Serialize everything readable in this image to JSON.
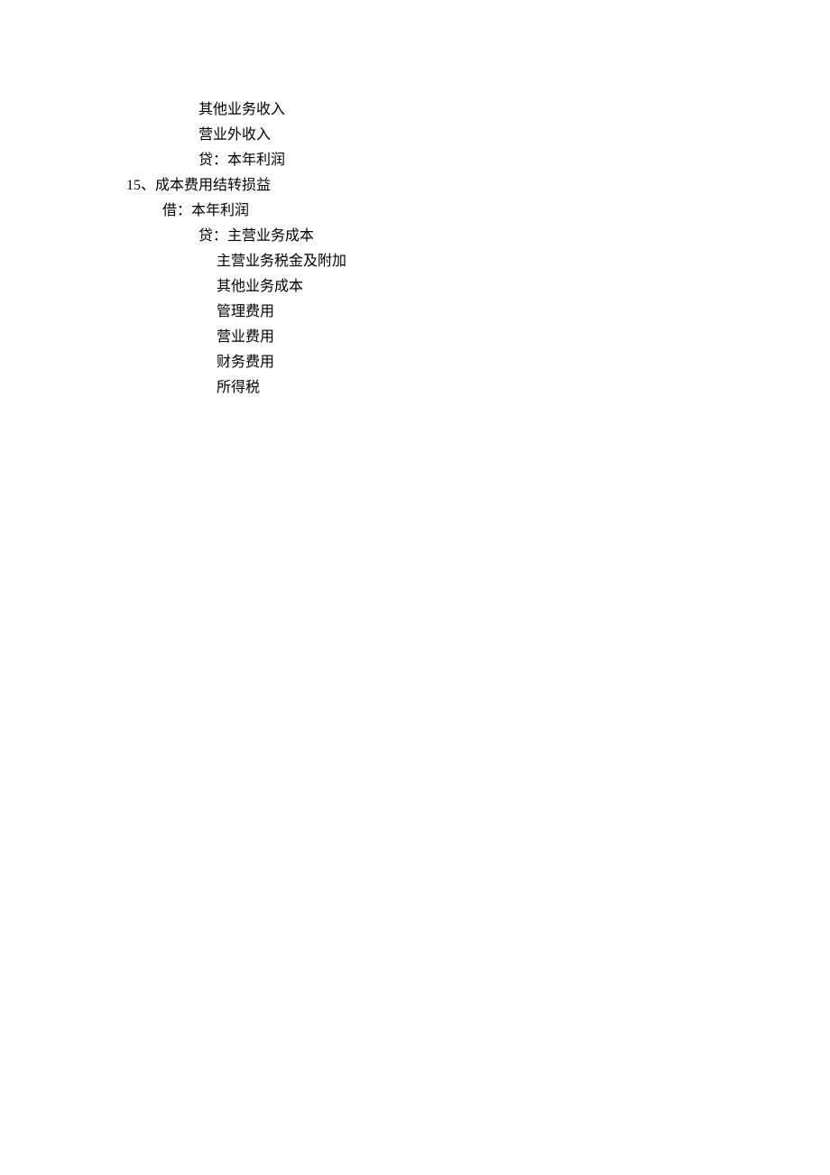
{
  "lines": [
    {
      "indent": "indent-3",
      "text": "其他业务收入"
    },
    {
      "indent": "indent-3",
      "text": "营业外收入"
    },
    {
      "indent": "indent-3",
      "text": "贷：本年利润"
    },
    {
      "indent": "indent-1",
      "text": "15、成本费用结转损益"
    },
    {
      "indent": "indent-2",
      "text": "借：本年利润"
    },
    {
      "indent": "indent-3",
      "text": "贷：主营业务成本"
    },
    {
      "indent": "indent-5",
      "text": "主营业务税金及附加"
    },
    {
      "indent": "indent-5",
      "text": "其他业务成本"
    },
    {
      "indent": "indent-5",
      "text": "管理费用"
    },
    {
      "indent": "indent-5",
      "text": "营业费用"
    },
    {
      "indent": "indent-5",
      "text": "财务费用"
    },
    {
      "indent": "indent-5",
      "text": "所得税"
    }
  ]
}
